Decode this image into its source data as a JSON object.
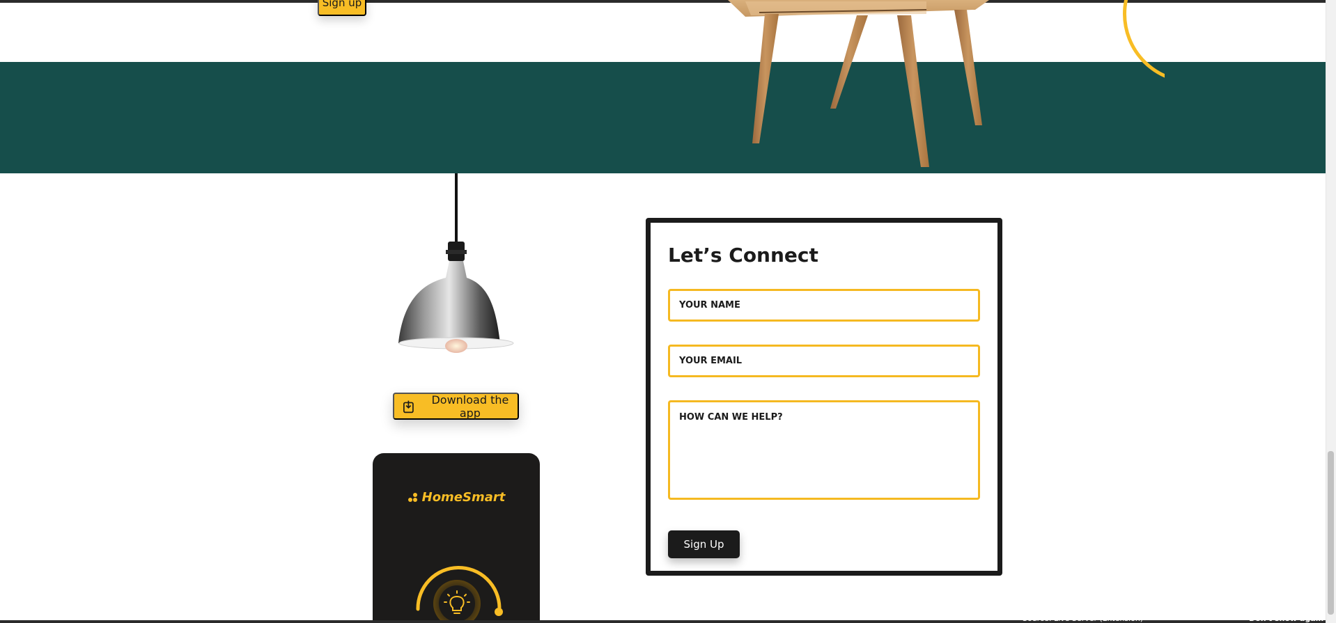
{
  "hero": {
    "signup_label": "Sign up"
  },
  "download": {
    "label": "Download the app"
  },
  "phone": {
    "brand": "HomeSmart"
  },
  "contact": {
    "title": "Let’s Connect",
    "name_placeholder": "YOUR NAME",
    "email_placeholder": "YOUR EMAIL",
    "help_placeholder": "HOW CAN WE HELP?",
    "submit_label": "Sign Up"
  },
  "status_bar": {
    "source_text": "Source: Live Server (Extension)",
    "dismiss_label": "Don't show again"
  },
  "colors": {
    "accent": "#f8bd25",
    "teal": "#164e4b",
    "dark": "#1b1b1b"
  },
  "icons": {
    "download": "download-icon",
    "brand_logo": "dots-logo-icon",
    "dial_center": "lightbulb-icon"
  }
}
